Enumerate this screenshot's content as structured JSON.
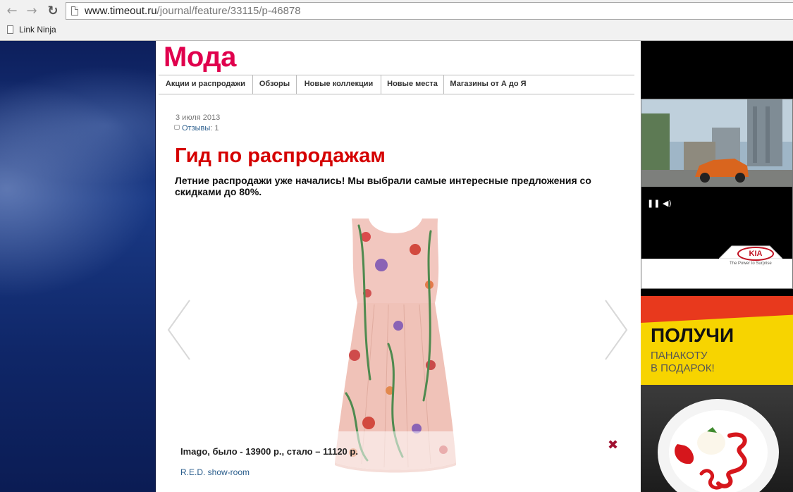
{
  "browser": {
    "url_host": "www.timeout.ru",
    "url_path": "/journal/feature/33115/p-46878",
    "bookmark": "Link Ninja"
  },
  "section": {
    "title": "Мода",
    "nav": [
      "Акции и распродажи",
      "Обзоры",
      "Новые коллекции",
      "Новые места",
      "Магазины от А до Я"
    ]
  },
  "article": {
    "date": "3 июля 2013",
    "reviews_label": "Отзывы",
    "reviews_count": ": 1",
    "headline": "Гид по распродажам",
    "lead": "Летние распродажи уже начались! Мы выбрали самые интересные предложения со скидками до 80%."
  },
  "slide": {
    "caption": "Imago, было - 13900 р., стало – 11120 р.",
    "link": "R.E.D. show-room"
  },
  "ads": {
    "kia_logo": "KIA",
    "kia_slogan": "The Power to Surprise",
    "food_title": "ПОЛУЧИ",
    "food_sub_line1": "ПАНАКОТУ",
    "food_sub_line2": "В ПОДАРОК!"
  },
  "icons": {
    "back": "arrow-left",
    "forward": "arrow-right",
    "reload": "reload",
    "prev": "chevron-left",
    "next": "chevron-right",
    "close": "close-x"
  },
  "colors": {
    "section_title": "#e0004d",
    "headline": "#d50000",
    "link": "#2a5d8c",
    "close": "#a01030"
  }
}
